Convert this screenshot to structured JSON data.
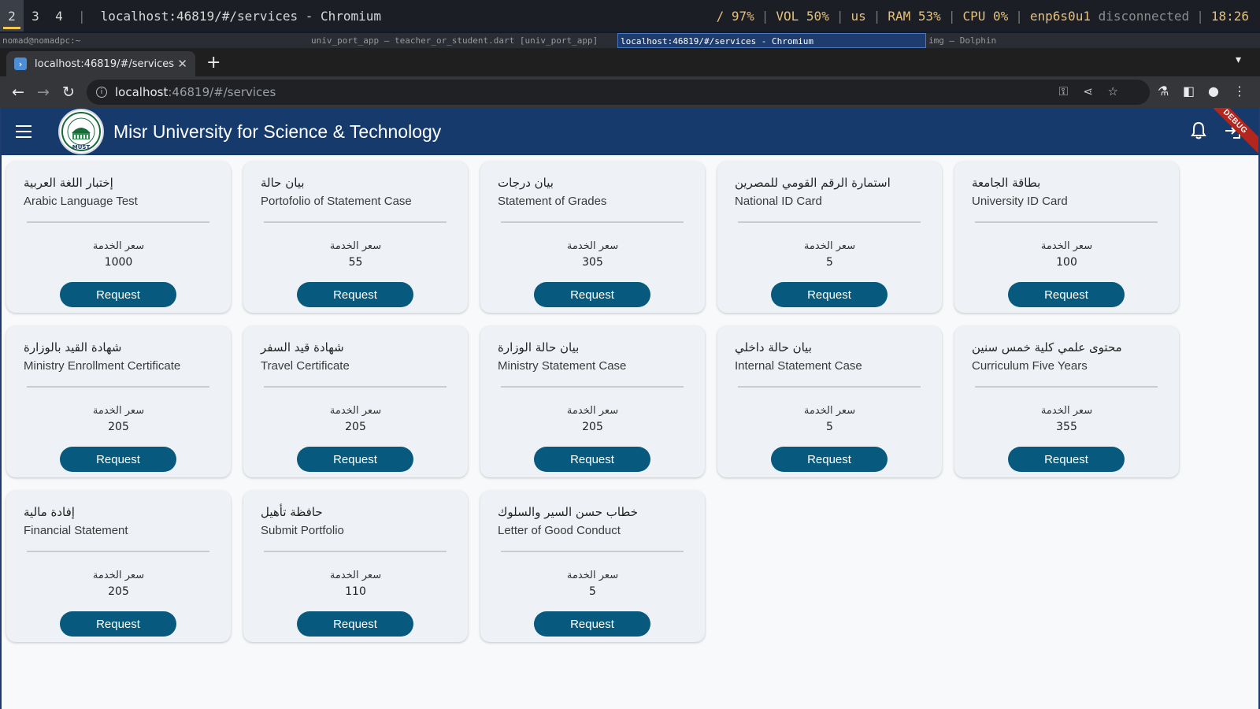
{
  "system_bar": {
    "workspaces": [
      "2",
      "3",
      "4"
    ],
    "window_title": "localhost:46819/#/services - Chromium",
    "battery": "/ 97%",
    "volume": "VOL 50%",
    "layout": "us",
    "ram": "RAM 53%",
    "cpu": "CPU  0%",
    "net_iface": "enp6s0u1",
    "net_state": "disconnected",
    "clock": "18:26"
  },
  "window_titles": [
    "nomad@nomadpc:~",
    "univ_port_app – teacher_or_student.dart [univ_port_app]",
    "localhost:46819/#/services - Chromium",
    "img – Dolphin"
  ],
  "browser": {
    "tab_title": "localhost:46819/#/services",
    "url_host": "localhost",
    "url_rest": ":46819/#/services"
  },
  "app": {
    "title": "Misr University for Science & Technology",
    "debug_banner": "DEBUG",
    "logo_text": "MUST"
  },
  "services": [
    {
      "ar": "إختبار اللغة العربية",
      "en": "Arabic Language Test",
      "price_label": "سعر الخدمة",
      "price": "1000",
      "button": "Request"
    },
    {
      "ar": "بيان حالة",
      "en": "Portofolio of Statement Case",
      "price_label": "سعر الخدمة",
      "price": "55",
      "button": "Request"
    },
    {
      "ar": "بيان درجات",
      "en": "Statement of Grades",
      "price_label": "سعر الخدمة",
      "price": "305",
      "button": "Request"
    },
    {
      "ar": "استمارة الرقم القومي للمصرين",
      "en": "National ID Card",
      "price_label": "سعر الخدمة",
      "price": "5",
      "button": "Request"
    },
    {
      "ar": "بطاقة الجامعة",
      "en": "University ID Card",
      "price_label": "سعر الخدمة",
      "price": "100",
      "button": "Request"
    },
    {
      "ar": "شهادة القيد بالوزارة",
      "en": "Ministry Enrollment Certificate",
      "price_label": "سعر الخدمة",
      "price": "205",
      "button": "Request"
    },
    {
      "ar": "شهادة قيد السفر",
      "en": "Travel Certificate",
      "price_label": "سعر الخدمة",
      "price": "205",
      "button": "Request"
    },
    {
      "ar": "بيان حالة الوزارة",
      "en": "Ministry Statement Case",
      "price_label": "سعر الخدمة",
      "price": "205",
      "button": "Request"
    },
    {
      "ar": "بيان حالة داخلي",
      "en": "Internal Statement Case",
      "price_label": "سعر الخدمة",
      "price": "5",
      "button": "Request"
    },
    {
      "ar": "محتوى علمي كلية خمس سنين",
      "en": "Curriculum Five Years",
      "price_label": "سعر الخدمة",
      "price": "355",
      "button": "Request"
    },
    {
      "ar": "إفادة مالية",
      "en": "Financial Statement",
      "price_label": "سعر الخدمة",
      "price": "205",
      "button": "Request"
    },
    {
      "ar": "حافظة تأهيل",
      "en": "Submit Portfolio",
      "price_label": "سعر الخدمة",
      "price": "110",
      "button": "Request"
    },
    {
      "ar": "خطاب حسن السير والسلوك",
      "en": "Letter of Good Conduct",
      "price_label": "سعر الخدمة",
      "price": "5",
      "button": "Request"
    }
  ],
  "colors": {
    "appbar": "#153a6b",
    "button": "#075a7e",
    "card": "#eef2f7"
  }
}
